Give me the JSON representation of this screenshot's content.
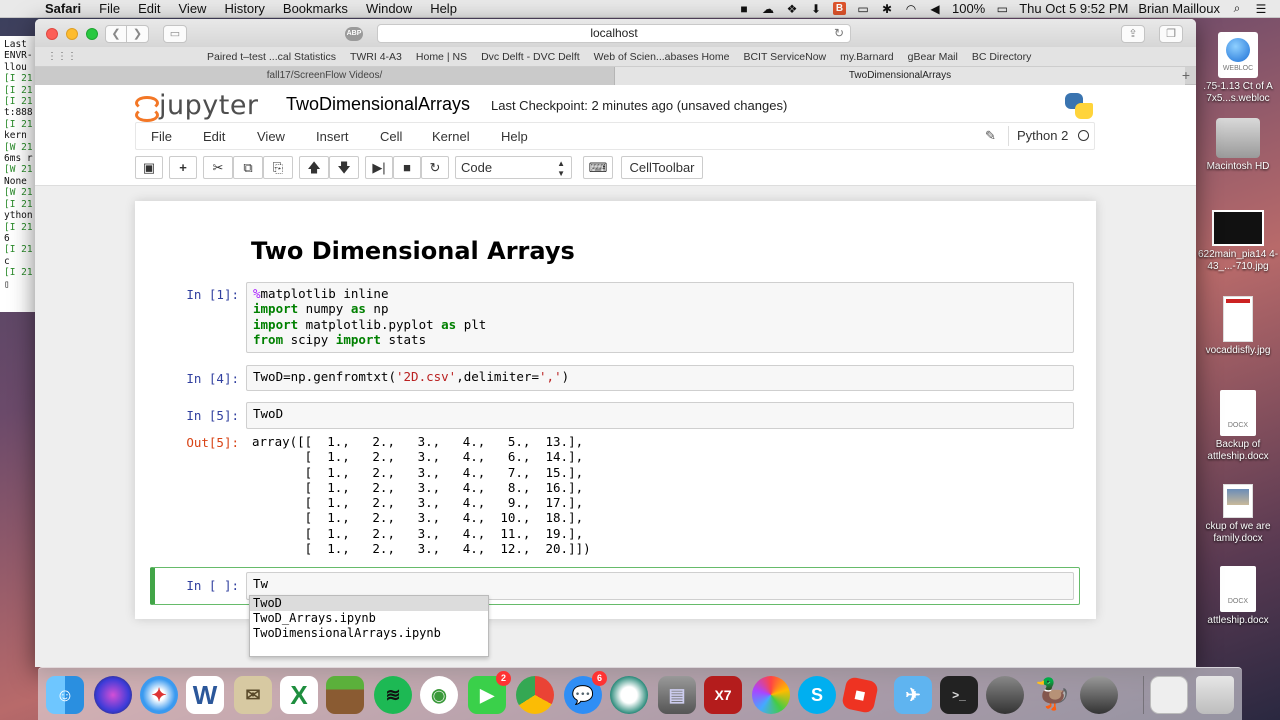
{
  "menubar": {
    "app": "Safari",
    "items": [
      "File",
      "Edit",
      "View",
      "History",
      "Bookmarks",
      "Window",
      "Help"
    ],
    "battery": "100%",
    "datetime": "Thu Oct 5  9:52 PM",
    "user": "Brian Mailloux"
  },
  "terminal_lines": [
    "Last",
    "ENVR-",
    "llou",
    "[I 21",
    "[I 21",
    "[I 21",
    "t:888",
    "[I 21",
    " kern",
    "[W 21",
    "6ms r",
    "[W 21",
    "None",
    "[W 21",
    "[I 21",
    "ython",
    "[I 21",
    "6",
    "[I 21",
    "c",
    "[I 21",
    "▯"
  ],
  "browser": {
    "address": "localhost",
    "adblock": "ABP",
    "bookmarks": [
      "Paired t–test ...cal Statistics",
      "TWRI 4-A3",
      "Home | NS",
      "Dvc Delft - DVC Delft",
      "Web of Scien...abases Home",
      "BCIT ServiceNow",
      "my.Barnard",
      "gBear Mail",
      "BC Directory"
    ],
    "tabs": [
      "fall17/ScreenFlow Videos/",
      "TwoDimensionalArrays"
    ]
  },
  "jupyter": {
    "logo_text": "jupyter",
    "notebook_name": "TwoDimensionalArrays",
    "checkpoint": "Last Checkpoint: 2 minutes ago (unsaved changes)",
    "menu": [
      "File",
      "Edit",
      "View",
      "Insert",
      "Cell",
      "Kernel",
      "Help"
    ],
    "kernel_name": "Python 2",
    "cell_type": "Code",
    "celltoolbar_label": "CellToolbar",
    "heading": "Two Dimensional Arrays",
    "cells": [
      {
        "prompt": "In [1]:",
        "lines": [
          [
            {
              "t": "%",
              "c": "mg"
            },
            {
              "t": "matplotlib inline",
              "c": ""
            }
          ],
          [
            {
              "t": "import",
              "c": "kw"
            },
            {
              "t": " numpy ",
              "c": ""
            },
            {
              "t": "as",
              "c": "kw"
            },
            {
              "t": " np",
              "c": ""
            }
          ],
          [
            {
              "t": "import",
              "c": "kw"
            },
            {
              "t": " matplotlib.pyplot ",
              "c": ""
            },
            {
              "t": "as",
              "c": "kw"
            },
            {
              "t": " plt",
              "c": ""
            }
          ],
          [
            {
              "t": "from",
              "c": "kw"
            },
            {
              "t": " scipy ",
              "c": ""
            },
            {
              "t": "import",
              "c": "kw"
            },
            {
              "t": " stats",
              "c": ""
            }
          ]
        ]
      },
      {
        "prompt": "In [4]:",
        "lines": [
          [
            {
              "t": "TwoD=np.genfromtxt(",
              "c": ""
            },
            {
              "t": "'2D.csv'",
              "c": "str"
            },
            {
              "t": ",delimiter=",
              "c": ""
            },
            {
              "t": "','",
              "c": "str"
            },
            {
              "t": ")",
              "c": ""
            }
          ]
        ]
      },
      {
        "prompt": "In [5]:",
        "lines": [
          [
            {
              "t": "TwoD",
              "c": ""
            }
          ]
        ]
      },
      {
        "prompt": "In [ ]:",
        "lines": [
          [
            {
              "t": "Tw",
              "c": ""
            }
          ]
        ]
      }
    ],
    "output_prompt": "Out[5]:",
    "output_lines": [
      "array([[  1.,   2.,   3.,   4.,   5.,  13.],",
      "       [  1.,   2.,   3.,   4.,   6.,  14.],",
      "       [  1.,   2.,   3.,   4.,   7.,  15.],",
      "       [  1.,   2.,   3.,   4.,   8.,  16.],",
      "       [  1.,   2.,   3.,   4.,   9.,  17.],",
      "       [  1.,   2.,   3.,   4.,  10.,  18.],",
      "       [  1.,   2.,   3.,   4.,  11.,  19.],",
      "       [  1.,   2.,   3.,   4.,  12.,  20.]])"
    ],
    "autocomplete": [
      "TwoD",
      "TwoD_Arrays.ipynb",
      "TwoDimensionalArrays.ipynb"
    ]
  },
  "desktop": {
    "webloc": {
      "tag": "WEBLOC",
      "label": ".75-1.13 Ct of A 7x5...s.webloc"
    },
    "disk": {
      "label": "Macintosh HD"
    },
    "photo1": {
      "label": "622main_pia14 4-43_...-710.jpg"
    },
    "photo2": {
      "label": "vocaddisfly.jpg"
    },
    "doc1": {
      "tag": "DOCX",
      "label": "Backup of attleship.docx"
    },
    "doc2": {
      "label": "ckup of we are family.docx"
    },
    "doc3": {
      "tag": "DOCX",
      "label": "attleship.docx"
    }
  },
  "dock": {
    "apps": [
      "finder-icon",
      "siri-icon",
      "safari-icon",
      "word-icon",
      "preview-icon",
      "excel-icon",
      "minecraft-icon",
      "spotify-icon",
      "anaconda-icon",
      "facetime-icon",
      "chrome-icon",
      "messages-icon",
      "quickshare-icon",
      "photostransfer-icon",
      "endnote-icon",
      "photos-icon",
      "skype-icon",
      "roblox-icon",
      "paperplane-icon",
      "terminal-icon",
      "screenflow-icon",
      "cyberduck-icon",
      "screenflow2-icon",
      "documents-icon",
      "trash-icon"
    ],
    "facetime_badge": "2",
    "messages_badge": "6",
    "endnote_label": "X7"
  }
}
